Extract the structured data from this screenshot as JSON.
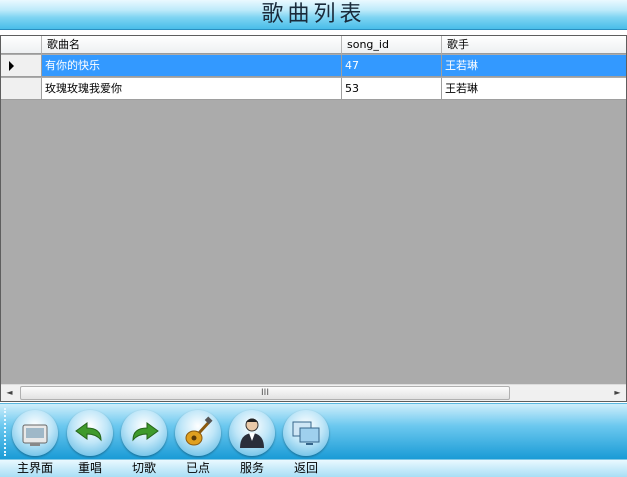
{
  "window": {
    "title": "歌曲列表"
  },
  "grid": {
    "columns": [
      "歌曲名",
      "song_id",
      "歌手"
    ],
    "rows": [
      {
        "selected": true,
        "cells": [
          "有你的快乐",
          "47",
          "王若琳"
        ]
      },
      {
        "selected": false,
        "cells": [
          "玫瑰玫瑰我爱你",
          "53",
          "王若琳"
        ]
      }
    ],
    "scrollbar": {
      "left_arrow": "◄",
      "right_arrow": "►",
      "thumb_grip": "III"
    }
  },
  "toolbar": {
    "buttons": [
      {
        "label": "主界面",
        "icon": "home-icon"
      },
      {
        "label": "重唱",
        "icon": "replay-arrow-icon"
      },
      {
        "label": "切歌",
        "icon": "next-song-arrow-icon"
      },
      {
        "label": "已点",
        "icon": "guitar-icon"
      },
      {
        "label": "服务",
        "icon": "waiter-icon"
      },
      {
        "label": "返回",
        "icon": "back-monitors-icon"
      }
    ]
  },
  "colors": {
    "accent": "#3399ff",
    "toolbar_blue": "#1a9bd6",
    "grid_background": "#ababab"
  }
}
